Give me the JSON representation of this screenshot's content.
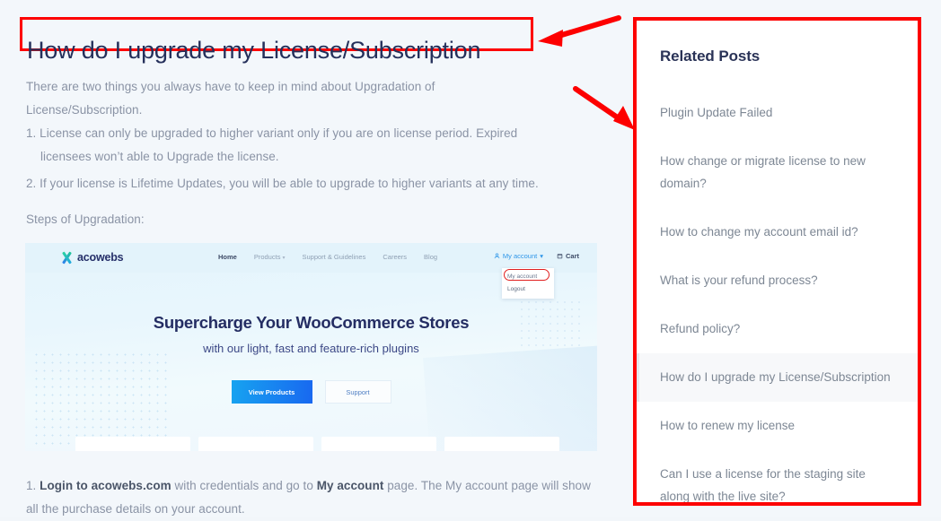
{
  "article": {
    "title": "How do I upgrade my License/Subscription",
    "intro": "There are two things you always have to keep in mind about Upgradation of License/Subscription.",
    "list_item_1_line1": "1. License can only be upgraded to higher variant only if you are on license period. Expired",
    "list_item_1_line2": "licensees won’t able to Upgrade the license.",
    "list_item_2": "2. If your license is Lifetime Updates, you will be able to upgrade to higher variants at any time.",
    "steps_label": "Steps of Upgradation:",
    "closing_prefix": "1. ",
    "closing_bold_1": "Login to acowebs.com",
    "closing_middle": " with credentials and go to ",
    "closing_bold_2": "My account",
    "closing_suffix": " page. The My account page will show all the purchase details on your account."
  },
  "embedded_screenshot": {
    "logo_text": "acowebs",
    "nav_links": [
      {
        "label": "Home",
        "has_caret": false,
        "active": true
      },
      {
        "label": "Products",
        "has_caret": true,
        "active": false
      },
      {
        "label": "Support & Guidelines",
        "has_caret": false,
        "active": false
      },
      {
        "label": "Careers",
        "has_caret": false,
        "active": false
      },
      {
        "label": "Blog",
        "has_caret": false,
        "active": false
      }
    ],
    "account_label": "My account",
    "cart_label": "Cart",
    "dropdown": {
      "item_my_account": "My account",
      "item_logout": "Logout"
    },
    "hero_title": "Supercharge Your WooCommerce Stores",
    "hero_subtitle": "with our light, fast and feature-rich plugins",
    "cta_primary": "View Products",
    "cta_secondary": "Support"
  },
  "sidebar": {
    "title": "Related Posts",
    "posts": [
      {
        "label": "Plugin Update Failed",
        "active": false
      },
      {
        "label": "How change or migrate license to new domain?",
        "active": false
      },
      {
        "label": "How to change my account email id?",
        "active": false
      },
      {
        "label": "What is your refund process?",
        "active": false
      },
      {
        "label": "Refund policy?",
        "active": false
      },
      {
        "label": "How do I upgrade my License/Subscription",
        "active": true
      },
      {
        "label": "How to renew my license",
        "active": false
      },
      {
        "label": "Can I use a license for the staging site along with the live site?",
        "active": false
      }
    ]
  },
  "annotations": {
    "highlight_color": "#fd0000",
    "arrow_color": "#fd0000",
    "title_highlight": "title-box",
    "sidebar_highlight": "related-posts-box",
    "arrow_1": "arrow-to-title",
    "arrow_2": "arrow-to-related-posts"
  },
  "colors": {
    "page_background": "#f3f7fb",
    "title_text": "#25305b",
    "body_text": "#8a93a5",
    "sidebar_title": "#2a3357",
    "sidebar_link": "#7d8794",
    "active_row_background": "#f7f8fa",
    "accent_red": "#fd0000",
    "brand_navy": "#242d63",
    "cta_blue": "#1868f0"
  }
}
